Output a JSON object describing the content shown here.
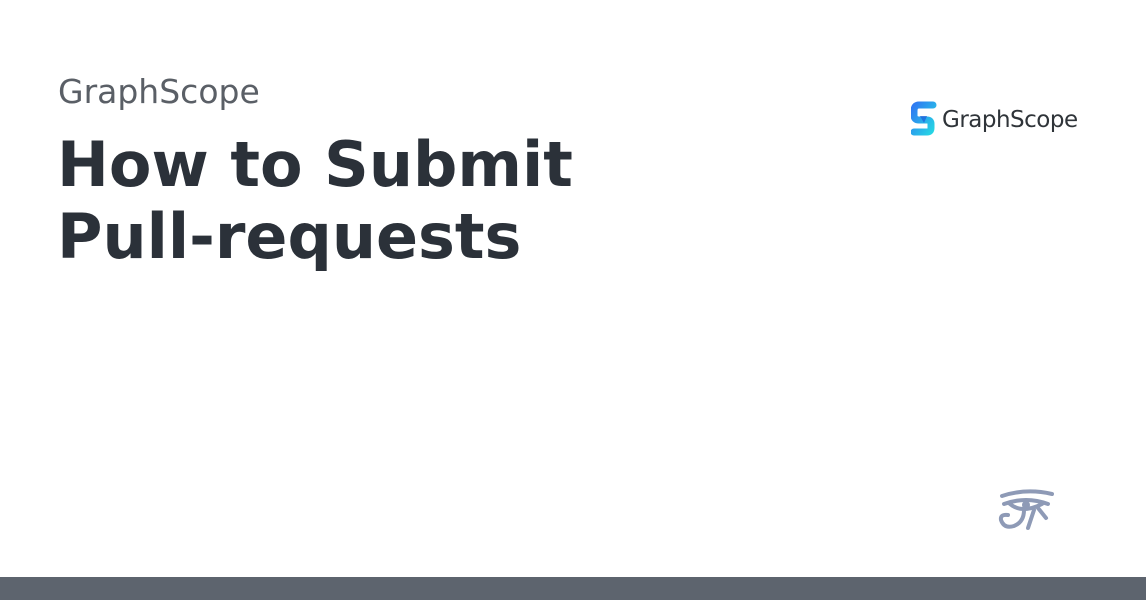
{
  "site": {
    "name": "GraphScope"
  },
  "page": {
    "title_lines": [
      "How to Submit",
      "Pull-requests"
    ]
  },
  "logo": {
    "text": "GraphScope",
    "icon": "graphscope-s-icon",
    "colors": {
      "gradient_start": "#2f7bf2",
      "gradient_end": "#26d6e4",
      "text": "#2f3439"
    }
  },
  "watermark": {
    "icon": "eye-of-horus-icon",
    "color": "#8e9ab6"
  },
  "colors": {
    "title": "#2b3139",
    "site_name": "#5a5f66",
    "footer_bar": "#5d646e",
    "background": "#ffffff"
  }
}
